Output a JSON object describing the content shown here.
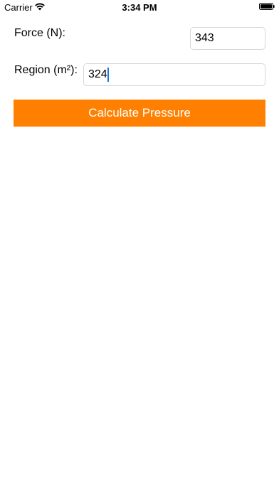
{
  "status_bar": {
    "carrier": "Carrier",
    "time": "3:34 PM"
  },
  "form": {
    "force_label": "Force (N):",
    "force_value": "343",
    "region_label": "Region (m²):",
    "region_value": "324"
  },
  "actions": {
    "calculate_label": "Calculate Pressure"
  },
  "colors": {
    "button_bg": "#ff8000",
    "button_text": "#ffffff",
    "caret": "#1a73e8"
  },
  "icons": {
    "wifi": "wifi-icon",
    "battery": "battery-icon"
  }
}
